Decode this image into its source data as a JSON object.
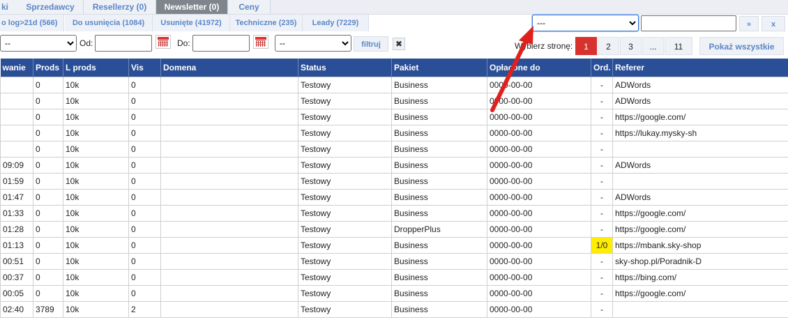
{
  "tabs": [
    "ki",
    "Sprzedawcy",
    "Resellerzy (0)",
    "Newsletter (0)",
    "Ceny"
  ],
  "subtabs": [
    "o log>21d (566)",
    "Do usunięcia (1084)",
    "Usunięte (41972)",
    "Techniczne (235)",
    "Leady (7229)"
  ],
  "filters": {
    "select1": "--",
    "od_label": "Od:",
    "do_label": "Do:",
    "select2": "--",
    "filter_button": "filtruj",
    "clear_button": "✖"
  },
  "top_right": {
    "select": "---",
    "search_value": "",
    "next_button": "»",
    "close_button": "x"
  },
  "pagination": {
    "label": "Wybierz stronę:",
    "pages": [
      "1",
      "2",
      "3",
      "...",
      "11"
    ],
    "active": "1",
    "show_all": "Pokaż wszystkie"
  },
  "table": {
    "headers": [
      "wanie",
      "Prods",
      "L prods",
      "Vis",
      "Domena",
      "Status",
      "Pakiet",
      "Opłacone do",
      "Ord.",
      "Referer"
    ],
    "rows": [
      [
        "",
        "0",
        "10k",
        "0",
        "",
        "Testowy",
        "Business",
        "0000-00-00",
        "-",
        "ADWords"
      ],
      [
        "",
        "0",
        "10k",
        "0",
        "",
        "Testowy",
        "Business",
        "0000-00-00",
        "-",
        "ADWords"
      ],
      [
        "",
        "0",
        "10k",
        "0",
        "",
        "Testowy",
        "Business",
        "0000-00-00",
        "-",
        "https://google.com/"
      ],
      [
        "",
        "0",
        "10k",
        "0",
        "",
        "Testowy",
        "Business",
        "0000-00-00",
        "-",
        "https://lukay.mysky-sh"
      ],
      [
        "",
        "0",
        "10k",
        "0",
        "",
        "Testowy",
        "Business",
        "0000-00-00",
        "-",
        ""
      ],
      [
        "09:09",
        "0",
        "10k",
        "0",
        "",
        "Testowy",
        "Business",
        "0000-00-00",
        "-",
        "ADWords"
      ],
      [
        "01:59",
        "0",
        "10k",
        "0",
        "",
        "Testowy",
        "Business",
        "0000-00-00",
        "-",
        ""
      ],
      [
        "01:47",
        "0",
        "10k",
        "0",
        "",
        "Testowy",
        "Business",
        "0000-00-00",
        "-",
        "ADWords"
      ],
      [
        "01:33",
        "0",
        "10k",
        "0",
        "",
        "Testowy",
        "Business",
        "0000-00-00",
        "-",
        "https://google.com/"
      ],
      [
        "01:28",
        "0",
        "10k",
        "0",
        "",
        "Testowy",
        "DropperPlus",
        "0000-00-00",
        "-",
        "https://google.com/"
      ],
      [
        "01:13",
        "0",
        "10k",
        "0",
        "",
        "Testowy",
        "Business",
        "0000-00-00",
        "1/0",
        "https://mbank.sky-shop"
      ],
      [
        "00:51",
        "0",
        "10k",
        "0",
        "",
        "Testowy",
        "Business",
        "0000-00-00",
        "-",
        "sky-shop.pl/Poradnik-D"
      ],
      [
        "00:37",
        "0",
        "10k",
        "0",
        "",
        "Testowy",
        "Business",
        "0000-00-00",
        "-",
        "https://bing.com/"
      ],
      [
        "00:05",
        "0",
        "10k",
        "0",
        "",
        "Testowy",
        "Business",
        "0000-00-00",
        "-",
        "https://google.com/"
      ],
      [
        "02:40",
        "3789",
        "10k",
        "2",
        "",
        "Testowy",
        "Business",
        "0000-00-00",
        "-",
        ""
      ]
    ]
  },
  "colors": {
    "header_bg": "#2a4f96",
    "active_page": "#d8322f",
    "highlight": "#ffee00",
    "arrow": "#e0201c"
  }
}
